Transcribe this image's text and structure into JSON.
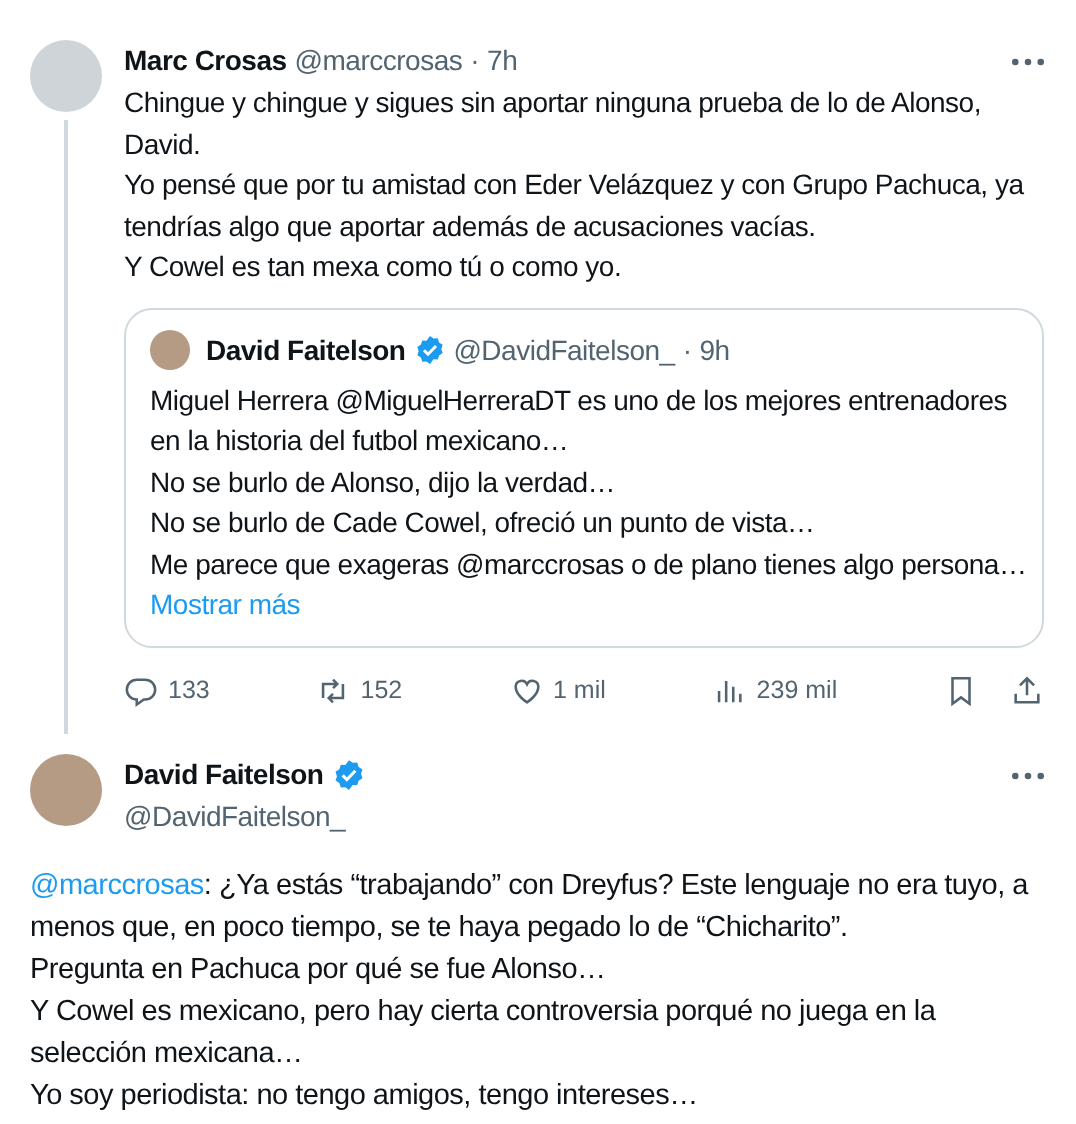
{
  "tweet": {
    "author": "Marc Crosas",
    "handle": "@marccrosas",
    "time": "7h",
    "separator": "·",
    "lines": [
      "Chingue y chingue y sigues sin aportar ninguna prueba de lo de Alonso, David.",
      "Yo pensé que por tu amistad con Eder Velázquez y con Grupo Pachuca, ya tendrías algo que aportar además de acusaciones vacías.",
      "Y Cowel es tan mexa como tú o como yo."
    ],
    "quote": {
      "author": "David Faitelson",
      "handle": "@DavidFaitelson_",
      "time": "9h",
      "separator": "·",
      "verified": true,
      "lines": [
        "Miguel Herrera @MiguelHerreraDT es uno de los mejores entrenadores en la historia del futbol mexicano…",
        "No se burlo de Alonso, dijo la verdad…",
        "No se burlo de Cade Cowel, ofreció un punto de vista…",
        "Me parece que exageras @marccrosas o de plano tienes algo persona…"
      ],
      "more": "Mostrar más"
    },
    "actions": [
      {
        "kind": "reply",
        "count": "133"
      },
      {
        "kind": "repost",
        "count": "152"
      },
      {
        "kind": "like",
        "count": "1 mil"
      },
      {
        "kind": "views",
        "count": "239 mil"
      },
      {
        "kind": "bookmark"
      },
      {
        "kind": "share"
      }
    ]
  },
  "reply": {
    "author": "David Faitelson",
    "handle": "@DavidFaitelson_",
    "verified": true,
    "paragraphs": [
      {
        "mention": "@marccrosas",
        "text": ": ¿Ya estás “trabajando” con Dreyfus? Este lenguaje no era tuyo, a menos que, en poco tiempo, se te haya pegado lo de “Chicharito”."
      },
      {
        "text": "Pregunta en Pachuca por qué se fue Alonso…"
      },
      {
        "text": "Y Cowel es mexicano, pero hay cierta controversia porqué no juega en la selección mexicana…"
      },
      {
        "text": "Yo soy periodista: no tengo amigos, tengo intereses…"
      }
    ]
  }
}
